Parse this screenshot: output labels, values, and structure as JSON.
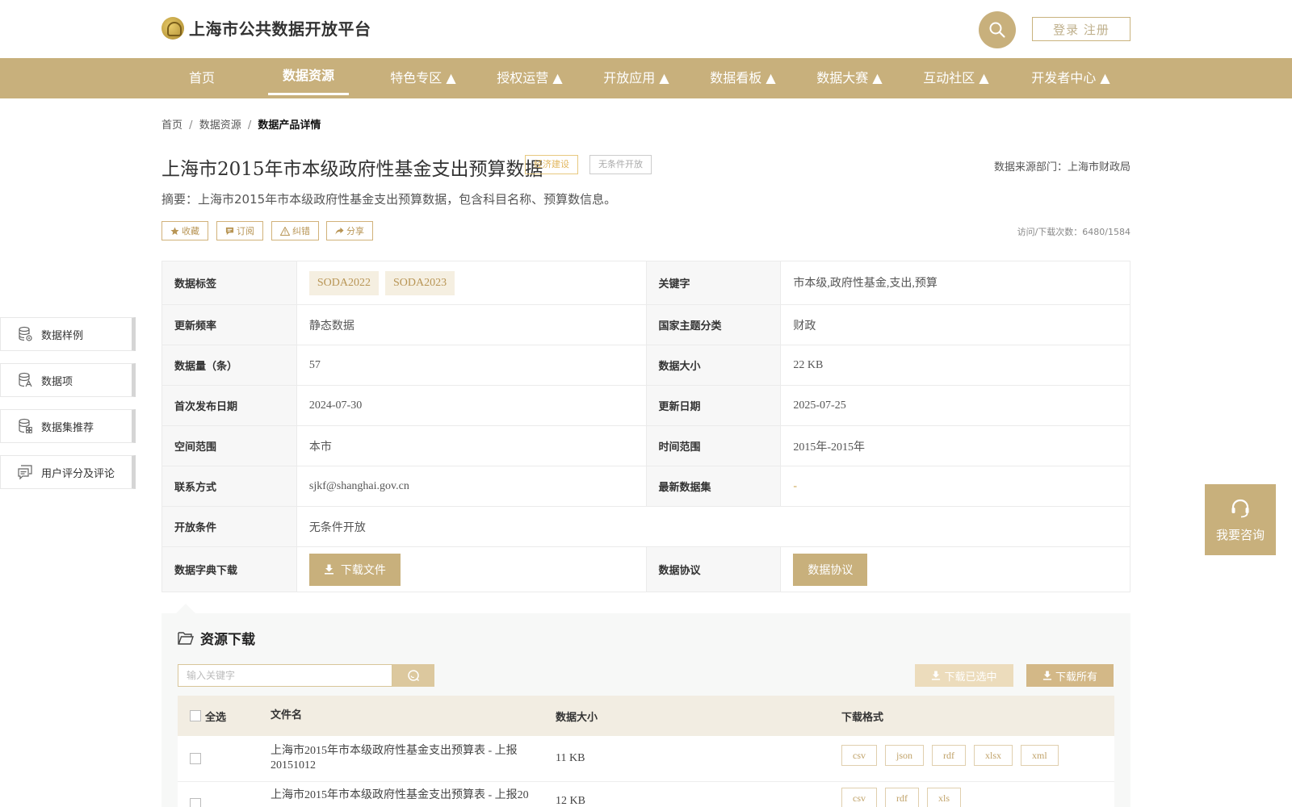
{
  "header": {
    "logo_text": "上海市公共数据开放平台",
    "login_label": "登录 注册"
  },
  "nav": {
    "items": [
      {
        "label": "首页"
      },
      {
        "label": "数据资源"
      },
      {
        "label": "特色专区 ▲"
      },
      {
        "label": "授权运营 ▲"
      },
      {
        "label": "开放应用 ▲"
      },
      {
        "label": "数据看板 ▲"
      },
      {
        "label": "数据大赛 ▲"
      },
      {
        "label": "互动社区 ▲"
      },
      {
        "label": "开发者中心 ▲"
      }
    ],
    "active_index": 1
  },
  "breadcrumb": {
    "home": "首页",
    "section": "数据资源",
    "current": "数据产品详情",
    "separator": "/"
  },
  "dataset": {
    "title": "上海市2015年市本级政府性基金支出预算数据",
    "tag_category": "经济建设",
    "tag_open": "无条件开放",
    "source": "数据来源部门：上海市财政局",
    "summary": "摘要：上海市2015年市本级政府性基金支出预算数据，包含科目名称、预算数信息。",
    "visits": "访问/下载次数：6480/1584"
  },
  "actions": {
    "favorite": "收藏",
    "subscribe": "订阅",
    "correct": "纠错",
    "share": "分享"
  },
  "info": {
    "tags_label": "数据标签",
    "tags": [
      "SODA2022",
      "SODA2023"
    ],
    "keywords_label": "关键字",
    "keywords": "市本级,政府性基金,支出,预算",
    "freq_label": "更新频率",
    "freq": "静态数据",
    "theme_label": "国家主题分类",
    "theme": "财政",
    "count_label": "数据量（条）",
    "count": "57",
    "size_label": "数据大小",
    "size": "22 KB",
    "first_pub_label": "首次发布日期",
    "first_pub": "2024-07-30",
    "updated_label": "更新日期",
    "updated": "2025-07-25",
    "spatial_label": "空间范围",
    "spatial": "本市",
    "time_label": "时间范围",
    "time": "2015年-2015年",
    "contact_label": "联系方式",
    "contact": "sjkf@shanghai.gov.cn",
    "latest_label": "最新数据集",
    "latest": "-",
    "condition_label": "开放条件",
    "condition": "无条件开放",
    "dict_label": "数据字典下载",
    "dict_button": "下载文件",
    "agreement_label": "数据协议",
    "agreement_button": "数据协议"
  },
  "side_menu": {
    "items": [
      {
        "label": "数据样例"
      },
      {
        "label": "数据项"
      },
      {
        "label": "数据集推荐"
      },
      {
        "label": "用户评分及评论"
      }
    ]
  },
  "consult": {
    "label": "我要咨询"
  },
  "resources": {
    "title": "资源下载",
    "search_placeholder": "输入关键字",
    "download_selected": "下载已选中",
    "download_all": "下载所有",
    "headers": {
      "select_all": "全选",
      "filename": "文件名",
      "size": "数据大小",
      "format": "下载格式"
    },
    "rows": [
      {
        "name": "上海市2015年市本级政府性基金支出预算表 - 上报20151012",
        "size": "11 KB",
        "formats": [
          "csv",
          "json",
          "rdf",
          "xlsx",
          "xml"
        ]
      },
      {
        "name": "上海市2015年市本级政府性基金支出预算表 - 上报20",
        "size": "12 KB",
        "formats": [
          "csv",
          "rdf",
          "xls"
        ]
      }
    ]
  },
  "colors": {
    "accent": "#c8b07c",
    "accent_light": "#f5efe1",
    "tag_orange": "#e2b75f"
  }
}
